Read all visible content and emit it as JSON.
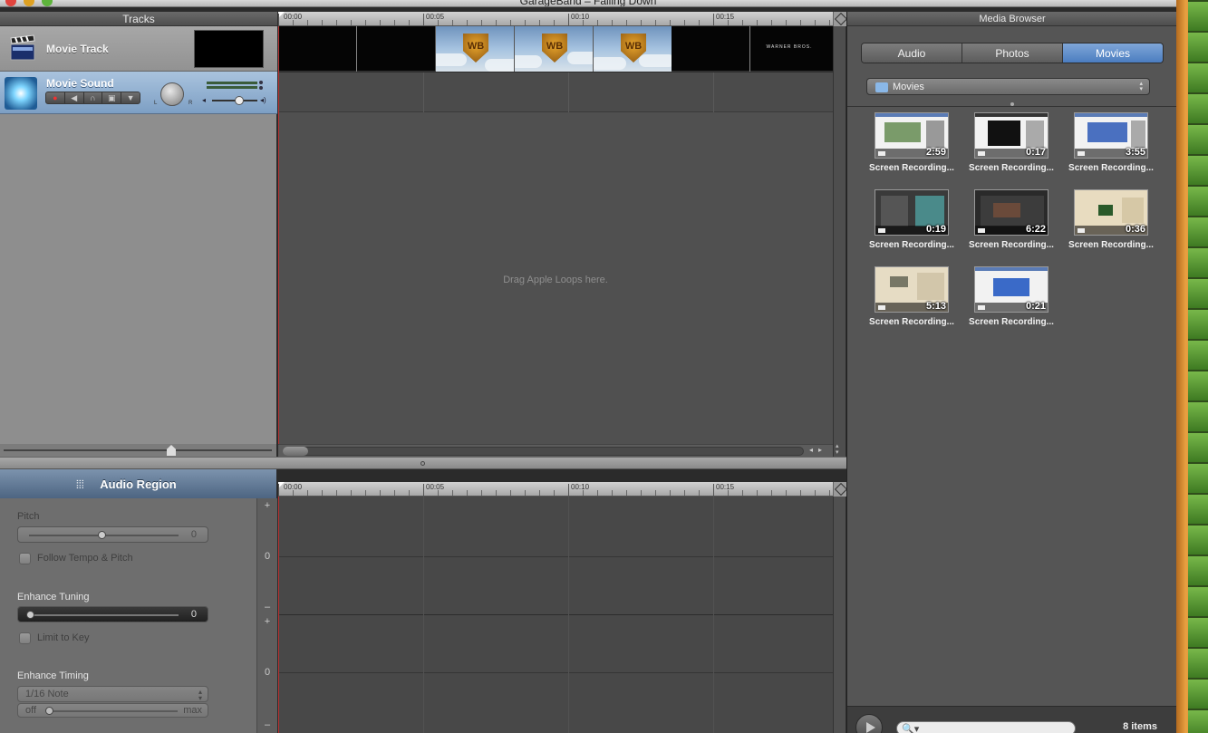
{
  "window": {
    "title": "GarageBand – Falling Down"
  },
  "tracks": {
    "header": "Tracks",
    "movie_track": {
      "name": "Movie Track"
    },
    "movie_sound": {
      "name": "Movie Sound",
      "knob_left": "L",
      "knob_right": "R"
    }
  },
  "timeline": {
    "ruler_labels": [
      "00:00",
      "00:05",
      "00:10",
      "00:15"
    ],
    "drag_hint": "Drag Apple Loops here.",
    "video_end_text": "WARNER BROS.",
    "wb_logo_letters": "WB"
  },
  "audio_region": {
    "title": "Audio Region",
    "pitch_label": "Pitch",
    "pitch_value": "0",
    "follow_tempo_label": "Follow Tempo & Pitch",
    "enhance_tuning_label": "Enhance Tuning",
    "enhance_tuning_value": "0",
    "limit_to_key_label": "Limit to Key",
    "enhance_timing_label": "Enhance Timing",
    "timing_note": "1/16 Note",
    "timing_off": "off",
    "timing_max": "max",
    "scale_plus": "+",
    "scale_zero": "0",
    "scale_minus": "–"
  },
  "media_browser": {
    "header": "Media Browser",
    "tabs": [
      "Audio",
      "Photos",
      "Movies"
    ],
    "active_tab": "Movies",
    "source": "Movies",
    "items": [
      {
        "caption": "Screen Recording...",
        "duration": "2:59"
      },
      {
        "caption": "Screen Recording...",
        "duration": "0:17"
      },
      {
        "caption": "Screen Recording...",
        "duration": "3:55"
      },
      {
        "caption": "Screen Recording...",
        "duration": "0:19"
      },
      {
        "caption": "Screen Recording...",
        "duration": "6:22"
      },
      {
        "caption": "Screen Recording...",
        "duration": "0:36"
      },
      {
        "caption": "Screen Recording...",
        "duration": "5:13"
      },
      {
        "caption": "Screen Recording...",
        "duration": "0:21"
      }
    ],
    "item_count": "8 items",
    "search_icon": "🔍▾"
  },
  "colors": {
    "accent": "#4b7dc0",
    "track_selected": "#7d9fc4",
    "playhead": "#bb3333"
  }
}
